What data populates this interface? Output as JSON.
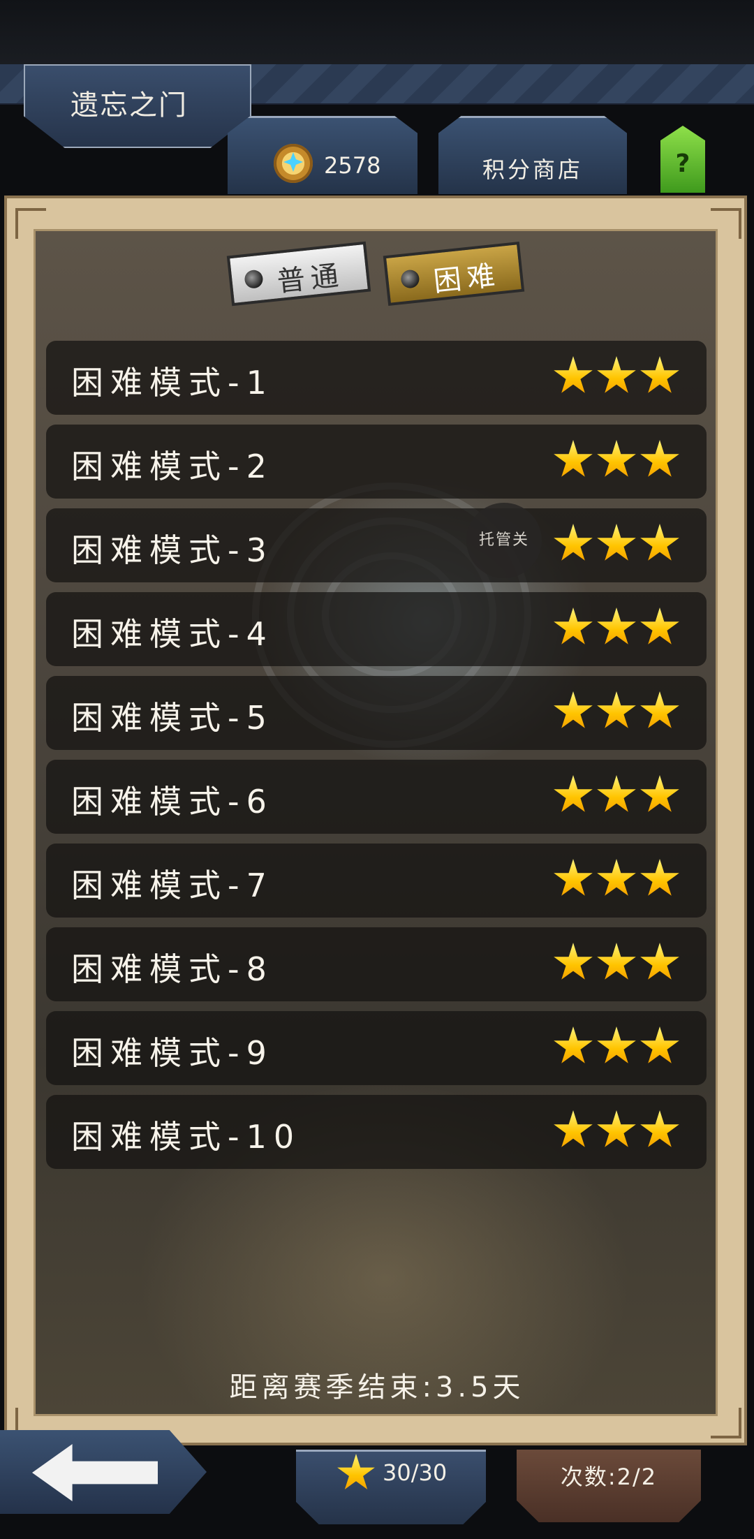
{
  "header": {
    "title": "遗忘之门",
    "currency_value": "2578",
    "shop_label": "积分商店",
    "help_label": "?"
  },
  "mode_tabs": [
    {
      "label": "普通",
      "selected": false
    },
    {
      "label": "困难",
      "selected": true
    }
  ],
  "levels": [
    {
      "name": "困难模式-1",
      "stars": 3
    },
    {
      "name": "困难模式-2",
      "stars": 3
    },
    {
      "name": "困难模式-3",
      "stars": 3
    },
    {
      "name": "困难模式-4",
      "stars": 3
    },
    {
      "name": "困难模式-5",
      "stars": 3
    },
    {
      "name": "困难模式-6",
      "stars": 3
    },
    {
      "name": "困难模式-7",
      "stars": 3
    },
    {
      "name": "困难模式-8",
      "stars": 3
    },
    {
      "name": "困难模式-9",
      "stars": 3
    },
    {
      "name": "困难模式-10",
      "stars": 3
    }
  ],
  "auto_badge": "托管关",
  "season_text": "距离赛季结束:3.5天",
  "footer": {
    "stars_text": "30/30",
    "count_text": "次数:2/2"
  },
  "icons": {
    "back": "arrow-left-icon",
    "currency": "medal-gem-icon",
    "star": "star-icon"
  },
  "colors": {
    "accent_gold": "#ffc400",
    "help_green": "#6fcf32",
    "panel_frame": "#d9c49e"
  }
}
